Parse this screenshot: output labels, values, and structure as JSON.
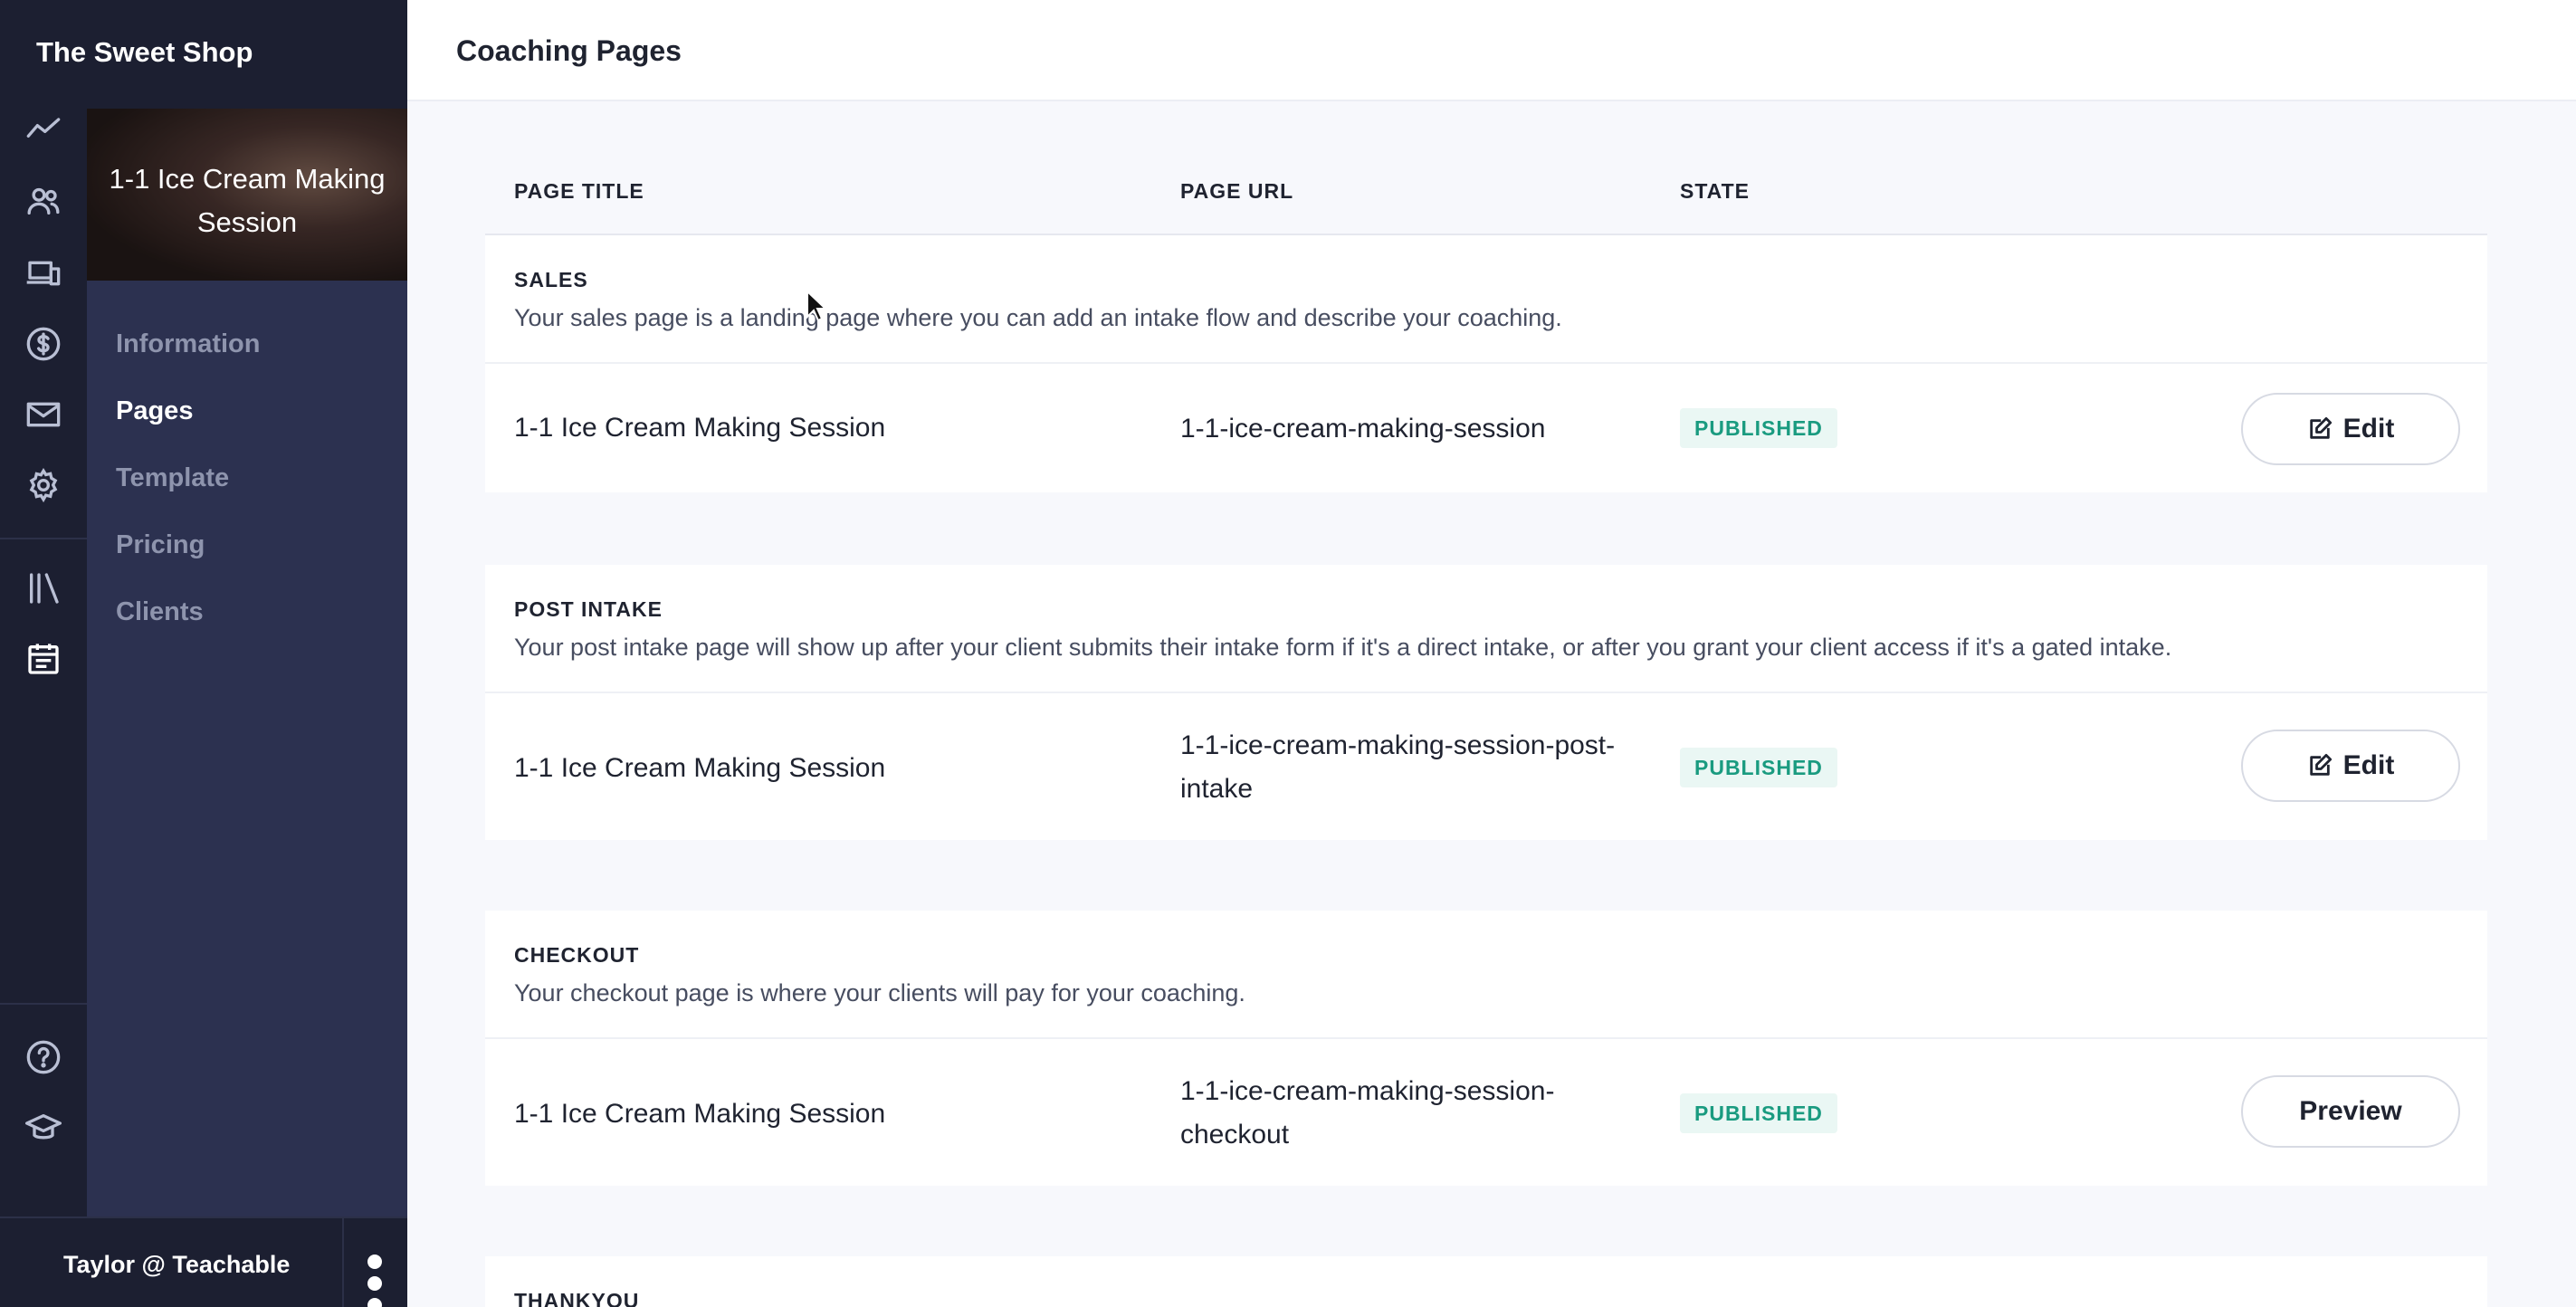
{
  "app": {
    "brand": "The Sweet Shop"
  },
  "rail": {
    "icons": [
      "analytics-icon",
      "users-icon",
      "devices-icon",
      "dollar-icon",
      "mail-icon",
      "gear-icon",
      "library-icon",
      "calendar-icon",
      "help-icon",
      "graduation-cap-icon"
    ],
    "active": "calendar-icon"
  },
  "course": {
    "title": "1-1 Ice Cream Making Session"
  },
  "subnav": {
    "items": [
      {
        "label": "Information"
      },
      {
        "label": "Pages"
      },
      {
        "label": "Template"
      },
      {
        "label": "Pricing"
      },
      {
        "label": "Clients"
      }
    ],
    "active": "Pages"
  },
  "footer": {
    "user": "Taylor @ Teachable"
  },
  "header": {
    "title": "Coaching Pages"
  },
  "table": {
    "columns": {
      "title": "PAGE TITLE",
      "url": "PAGE URL",
      "state": "STATE"
    },
    "sections": [
      {
        "label": "SALES",
        "description": "Your sales page is a landing page where you can add an intake flow and describe your coaching.",
        "row": {
          "title": "1-1 Ice Cream Making Session",
          "url": "1-1-ice-cream-making-session",
          "state": "PUBLISHED",
          "action": "Edit"
        }
      },
      {
        "label": "POST INTAKE",
        "description": "Your post intake page will show up after your client submits their intake form if it's a direct intake, or after you grant your client access if it's a gated intake.",
        "row": {
          "title": "1-1 Ice Cream Making Session",
          "url": "1-1-ice-cream-making-session-post-intake",
          "state": "PUBLISHED",
          "action": "Edit"
        }
      },
      {
        "label": "CHECKOUT",
        "description": "Your checkout page is where your clients will pay for your coaching.",
        "row": {
          "title": "1-1 Ice Cream Making Session",
          "url": "1-1-ice-cream-making-session-checkout",
          "state": "PUBLISHED",
          "action": "Preview"
        }
      },
      {
        "label": "THANKYOU"
      }
    ]
  },
  "colors": {
    "published_text": "#1a9b80",
    "published_bg": "#eaf7f4",
    "rail_bg": "#1c1f31",
    "subnav_bg": "#2c3150"
  }
}
